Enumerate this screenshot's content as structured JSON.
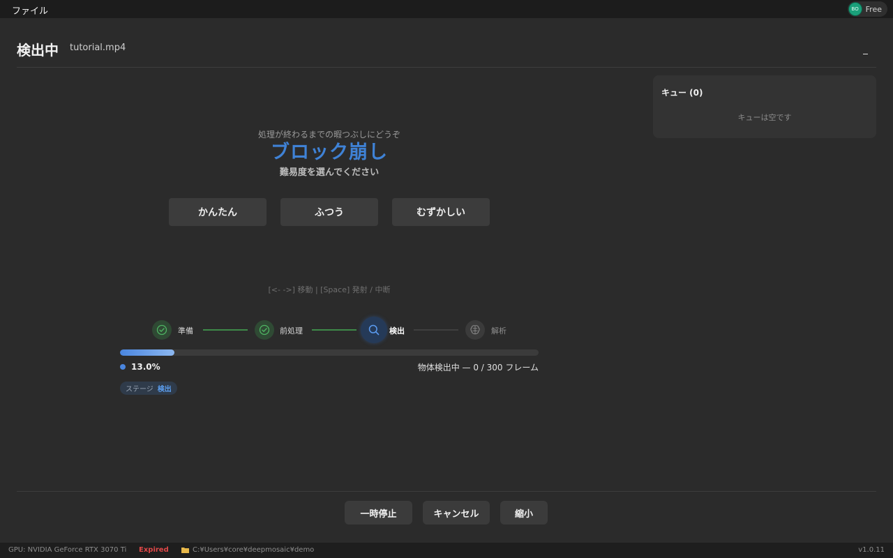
{
  "menu": {
    "file_label": "ファイル"
  },
  "account": {
    "initials": "BO",
    "plan": "Free"
  },
  "header": {
    "title": "検出中",
    "filename": "tutorial.mp4"
  },
  "queue": {
    "title": "キュー (0)",
    "empty_text": "キューは空です"
  },
  "game": {
    "hint": "処理が終わるまでの暇つぶしにどうぞ",
    "title": "ブロック崩し",
    "subtitle": "難易度を選んでください",
    "difficulties": [
      "かんたん",
      "ふつう",
      "むずかしい"
    ],
    "controls": "[<- ->] 移動 | [Space] 発射 / 中断"
  },
  "steps": [
    {
      "label": "準備",
      "state": "done",
      "icon": "check-icon"
    },
    {
      "label": "前処理",
      "state": "done",
      "icon": "check-icon"
    },
    {
      "label": "検出",
      "state": "active",
      "icon": "search-icon"
    },
    {
      "label": "解析",
      "state": "todo",
      "icon": "brain-icon"
    }
  ],
  "progress": {
    "percent_text": "13.0%",
    "fraction": 0.13,
    "status": "物体検出中 — 0 / 300 フレーム",
    "stage_key": "ステージ",
    "stage_value": "検出"
  },
  "actions": {
    "pause": "一時停止",
    "cancel": "キャンセル",
    "shrink": "縮小"
  },
  "statusbar": {
    "gpu": "GPU: NVIDIA GeForce RTX 3070 Ti",
    "license": "Expired",
    "path": "C:¥Users¥core¥deepmosaic¥demo",
    "version": "v1.0.11"
  },
  "colors": {
    "accent": "#4a86df",
    "done": "#3e9a4f",
    "expired": "#e04848",
    "background": "#2b2b2b"
  }
}
